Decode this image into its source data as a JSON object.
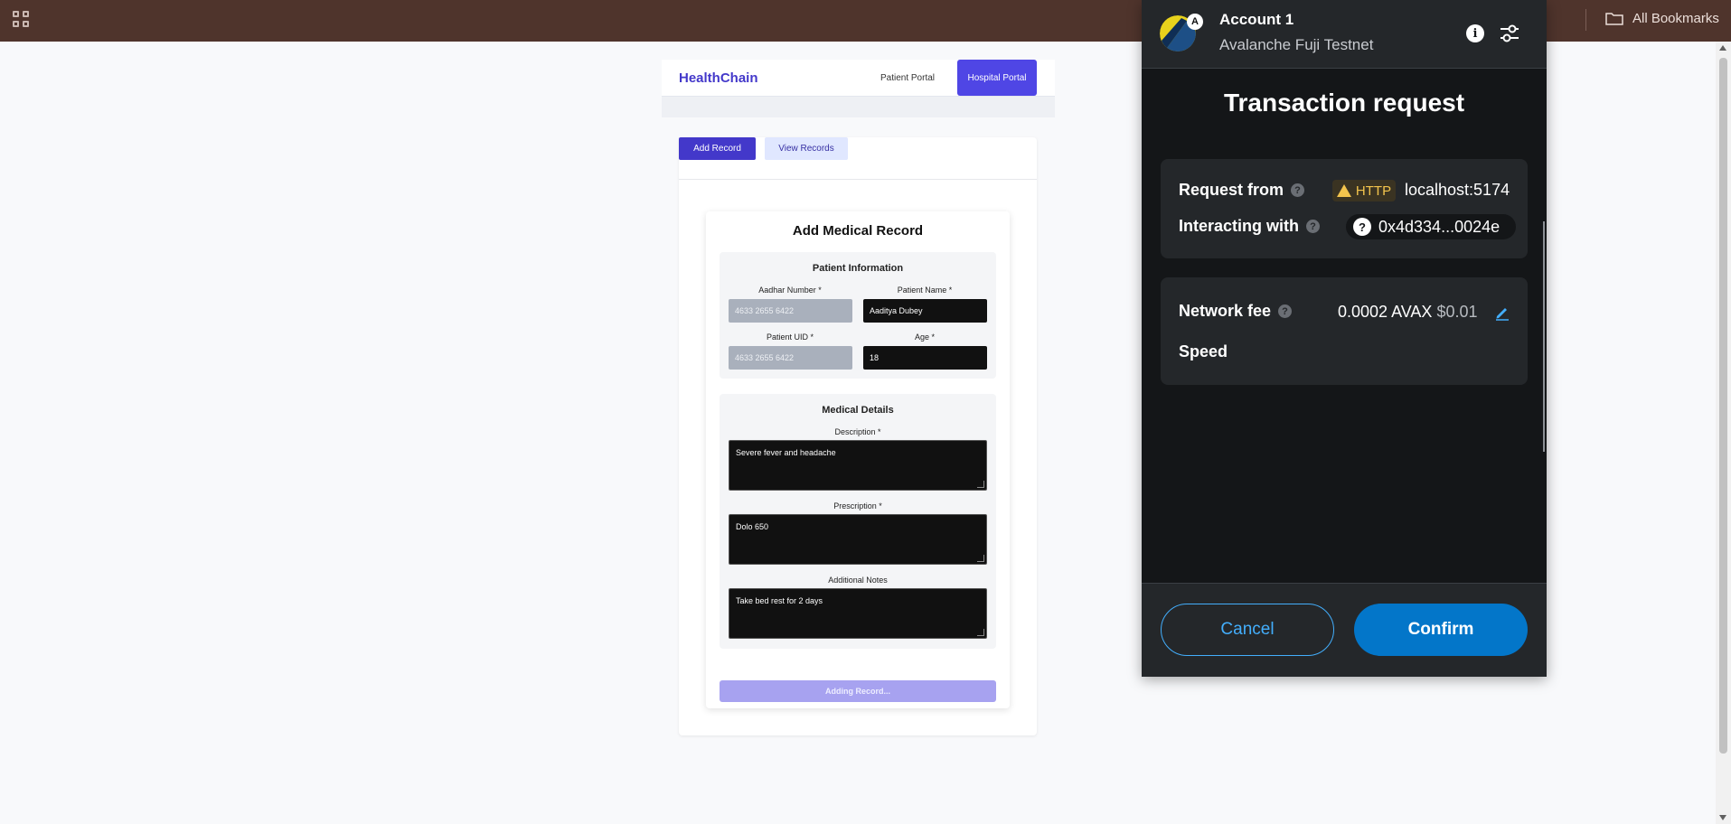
{
  "browser": {
    "bookmarks_label": "All Bookmarks",
    "apps_icon": "apps-grid-icon",
    "folder_icon": "folder-icon"
  },
  "app": {
    "brand": "HealthChain",
    "nav": {
      "patient": "Patient Portal",
      "hospital": "Hospital Portal"
    },
    "tabs": {
      "add": "Add Record",
      "view": "View Records"
    },
    "form": {
      "title": "Add Medical Record",
      "patient_section": "Patient Information",
      "aadhar_label": "Aadhar Number *",
      "aadhar_value": "4633 2655 6422",
      "name_label": "Patient Name *",
      "name_value": "Aaditya Dubey",
      "uid_label": "Patient UID *",
      "uid_value": "4633 2655 6422",
      "age_label": "Age *",
      "age_value": "18",
      "medical_section": "Medical Details",
      "description_label": "Description *",
      "description_value": "Severe fever and headache",
      "prescription_label": "Prescription *",
      "prescription_value": "Dolo 650",
      "notes_label": "Additional Notes",
      "notes_value": "Take bed rest for 2 days",
      "submit_label": "Adding Record..."
    },
    "colors": {
      "primary": "#4f46e5",
      "brand": "#4338ca"
    }
  },
  "wallet": {
    "account_name": "Account 1",
    "avatar_badge": "A",
    "network": "Avalanche Fuji Testnet",
    "title": "Transaction request",
    "request_from_label": "Request from",
    "http_badge": "HTTP",
    "origin": "localhost:5174",
    "interacting_with_label": "Interacting with",
    "contract_address": "0x4d334...0024e",
    "network_fee_label": "Network fee",
    "fee_amount": "0.0002 AVAX",
    "fee_fiat": "$0.01",
    "speed_label": "Speed",
    "cancel_label": "Cancel",
    "confirm_label": "Confirm",
    "info_glyph": "i",
    "help_glyph": "?",
    "colors": {
      "accent": "#43aefc",
      "confirm": "#0376c9",
      "warning": "#f3c44d"
    }
  }
}
